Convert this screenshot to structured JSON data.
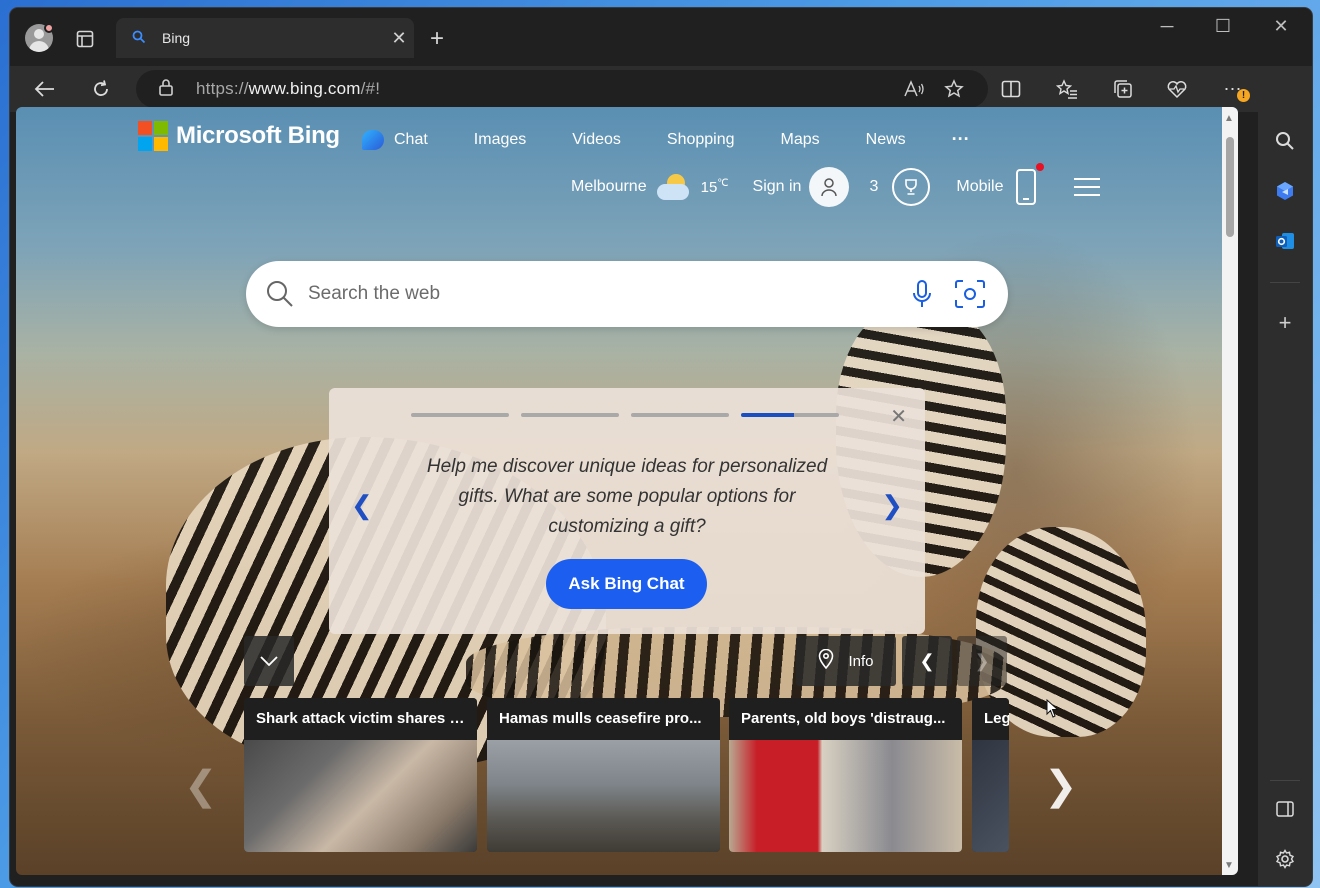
{
  "browser": {
    "tab_title": "Bing",
    "url_prefix": "https://",
    "url_host": "www.bing.com",
    "url_path": "/#!",
    "accent_color": "#3b8cff"
  },
  "bing": {
    "brand": "Microsoft Bing",
    "nav": {
      "chat": "Chat",
      "images": "Images",
      "videos": "Videos",
      "shopping": "Shopping",
      "maps": "Maps",
      "news": "News",
      "more": "···"
    },
    "weather": {
      "city": "Melbourne",
      "temp": "15",
      "unit": "℃"
    },
    "sign_in": "Sign in",
    "rewards_count": "3",
    "mobile": "Mobile",
    "search_placeholder": "Search the web"
  },
  "prompt_card": {
    "text": "Help me discover unique ideas for personalized gifts. What are some popular options for customizing a gift?",
    "button": "Ask Bing Chat",
    "progress_total": 4,
    "progress_active_index": 3,
    "accent_color": "#1b5ef0"
  },
  "controls": {
    "info_label": "Info"
  },
  "news": [
    {
      "title": "Shark attack victim shares '..."
    },
    {
      "title": "Hamas mulls ceasefire pro..."
    },
    {
      "title": "Parents, old boys 'distraug..."
    },
    {
      "title": "Leg"
    }
  ]
}
